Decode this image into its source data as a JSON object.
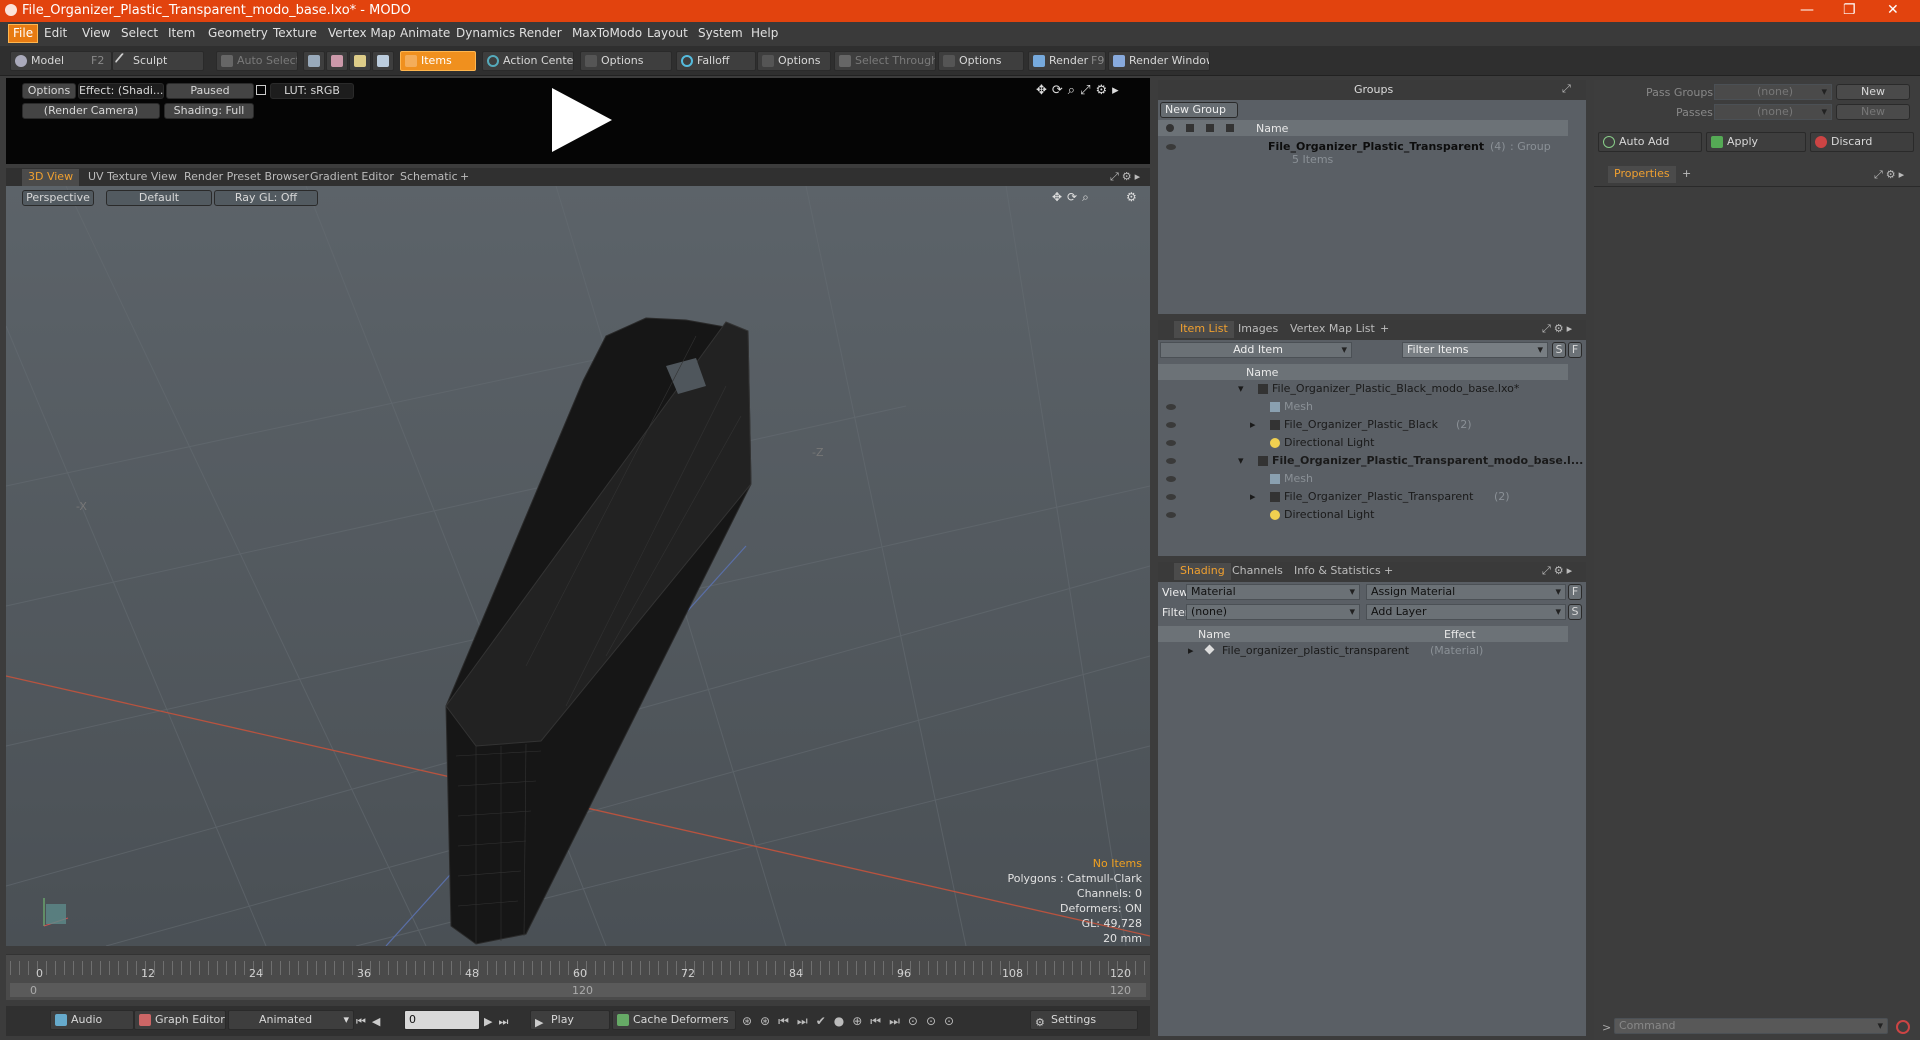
{
  "window": {
    "title": "File_Organizer_Plastic_Transparent_modo_base.lxo* - MODO",
    "min": "—",
    "max": "❐",
    "close": "✕"
  },
  "menu": [
    "File",
    "Edit",
    "View",
    "Select",
    "Item",
    "Geometry",
    "Texture",
    "Vertex Map",
    "Animate",
    "Dynamics",
    "Render",
    "MaxToModo",
    "Layout",
    "System",
    "Help"
  ],
  "toolbar": {
    "model": "Model",
    "model_key": "F2",
    "sculpt": "Sculpt",
    "auto_select": "Auto Select",
    "items": "Items",
    "action_center": "Action Center",
    "options1": "Options",
    "falloff": "Falloff",
    "options2": "Options",
    "select_through": "Select Through",
    "options3": "Options",
    "render": "Render",
    "render_key": "F9",
    "render_window": "Render Window"
  },
  "preview": {
    "options": "Options",
    "effect": "Effect: (Shadi...",
    "paused": "Paused",
    "lut": "LUT: sRGB",
    "camera": "(Render Camera)",
    "shading": "Shading: Full"
  },
  "view_tabs": [
    "3D View",
    "UV Texture View",
    "Render Preset Browser",
    "Gradient Editor",
    "Schematic",
    "+"
  ],
  "viewport": {
    "perspective": "Perspective",
    "default": "Default",
    "raygl": "Ray GL: Off",
    "axis_x": "-X",
    "axis_z": "-Z",
    "info": {
      "no_items": "No Items",
      "polygons": "Polygons : Catmull-Clark",
      "channels": "Channels: 0",
      "deformers": "Deformers: ON",
      "gl": "GL: 49,728",
      "size": "20 mm"
    }
  },
  "timeline": {
    "ticks": [
      "0",
      "12",
      "24",
      "36",
      "48",
      "60",
      "72",
      "84",
      "96",
      "108",
      "120"
    ],
    "sub_left": "0",
    "sub_mid": "120",
    "sub_right": "120"
  },
  "bottombar": {
    "audio": "Audio",
    "graph_editor": "Graph Editor",
    "animated": "Animated",
    "frame": "0",
    "play": "Play",
    "cache": "Cache Deformers",
    "settings": "Settings"
  },
  "groups": {
    "title": "Groups",
    "new_group": "New Group",
    "col_name": "Name",
    "item_name": "File_Organizer_Plastic_Transparent",
    "item_count": "(4)",
    "item_type": ": Group",
    "item_sub": "5 Items"
  },
  "itemlist": {
    "tabs": [
      "Item List",
      "Images",
      "Vertex Map List",
      "+"
    ],
    "add_item": "Add Item",
    "filter": "Filter Items",
    "s": "S",
    "f": "F",
    "col_name": "Name",
    "rows": [
      {
        "label": "File_Organizer_Plastic_Black_modo_base.lxo*",
        "extra": ""
      },
      {
        "label": "Mesh",
        "extra": ""
      },
      {
        "label": "File_Organizer_Plastic_Black",
        "extra": "(2)"
      },
      {
        "label": "Directional Light",
        "extra": ""
      },
      {
        "label": "File_Organizer_Plastic_Transparent_modo_base.l...",
        "extra": ""
      },
      {
        "label": "Mesh",
        "extra": ""
      },
      {
        "label": "File_Organizer_Plastic_Transparent",
        "extra": "(2)"
      },
      {
        "label": "Directional Light",
        "extra": ""
      }
    ]
  },
  "shading": {
    "tabs": [
      "Shading",
      "Channels",
      "Info & Statistics",
      "+"
    ],
    "view_label": "View",
    "view_value": "Material",
    "assign": "Assign Material",
    "f": "F",
    "filter_label": "Filter",
    "filter_value": "(none)",
    "add_layer": "Add Layer",
    "s": "S",
    "col_name": "Name",
    "col_effect": "Effect",
    "item": "File_organizer_plastic_transparent",
    "item_type": "(Material)"
  },
  "pass": {
    "pass_groups": "Pass Groups",
    "passes": "Passes",
    "none1": "(none)",
    "none2": "(none)",
    "new1": "New",
    "new2": "New",
    "auto_add": "Auto Add",
    "apply": "Apply",
    "discard": "Discard",
    "properties": "Properties",
    "plus": "+",
    "command": "Command"
  }
}
